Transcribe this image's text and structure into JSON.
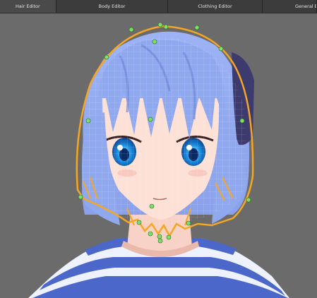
{
  "tabs": [
    {
      "label": "Hair Editor",
      "active": true
    },
    {
      "label": "Body Editor",
      "active": false
    },
    {
      "label": "Clothing Editor",
      "active": false
    },
    {
      "label": "General Edit",
      "active": false
    }
  ],
  "colors": {
    "viewport_bg": "#6b6b6b",
    "hair": "#8fa8ee",
    "hair_shade": "#6f86d8",
    "skin": "#fde0d6",
    "outline": "#f5a623",
    "control_point": "#7ee06a",
    "shirt_blue": "#4b67c9",
    "shirt_white": "#eef2ff",
    "hairclip": "#3d3a6e"
  }
}
